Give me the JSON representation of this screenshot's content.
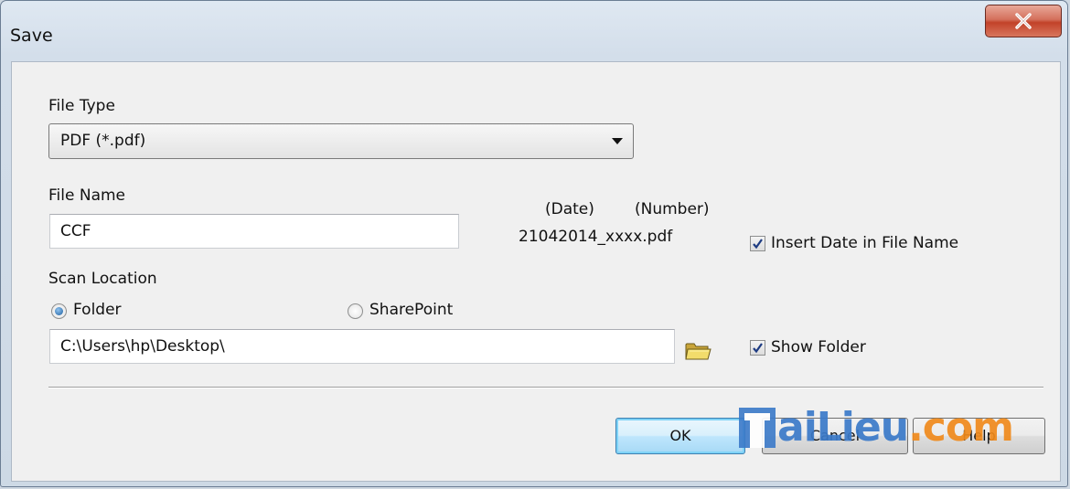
{
  "window": {
    "title": "Save",
    "close_glyph": "X"
  },
  "file_type": {
    "label": "File Type",
    "selected": "PDF (*.pdf)"
  },
  "file_name": {
    "label": "File Name",
    "value": "CCF",
    "date_caption": "(Date)",
    "number_caption": "(Number)",
    "example": "21042014_xxxx.pdf",
    "insert_date_label": "Insert Date in File Name",
    "insert_date_checked": true
  },
  "scan_location": {
    "label": "Scan Location",
    "folder_label": "Folder",
    "folder_selected": true,
    "sharepoint_label": "SharePoint",
    "path": "C:\\Users\\hp\\Desktop\\",
    "browse_icon": "folder-icon",
    "show_folder_label": "Show Folder",
    "show_folder_checked": true
  },
  "buttons": {
    "ok": "OK",
    "cancel": "Cancel",
    "help": "Help"
  },
  "watermark": {
    "text_1": "aiLieu",
    "text_2": ".com",
    "logo": "T"
  },
  "colors": {
    "accent": "#3c7fb1",
    "close": "#c24229",
    "watermark_blue": "#3b7ac9",
    "watermark_orange": "#f08a1c"
  }
}
